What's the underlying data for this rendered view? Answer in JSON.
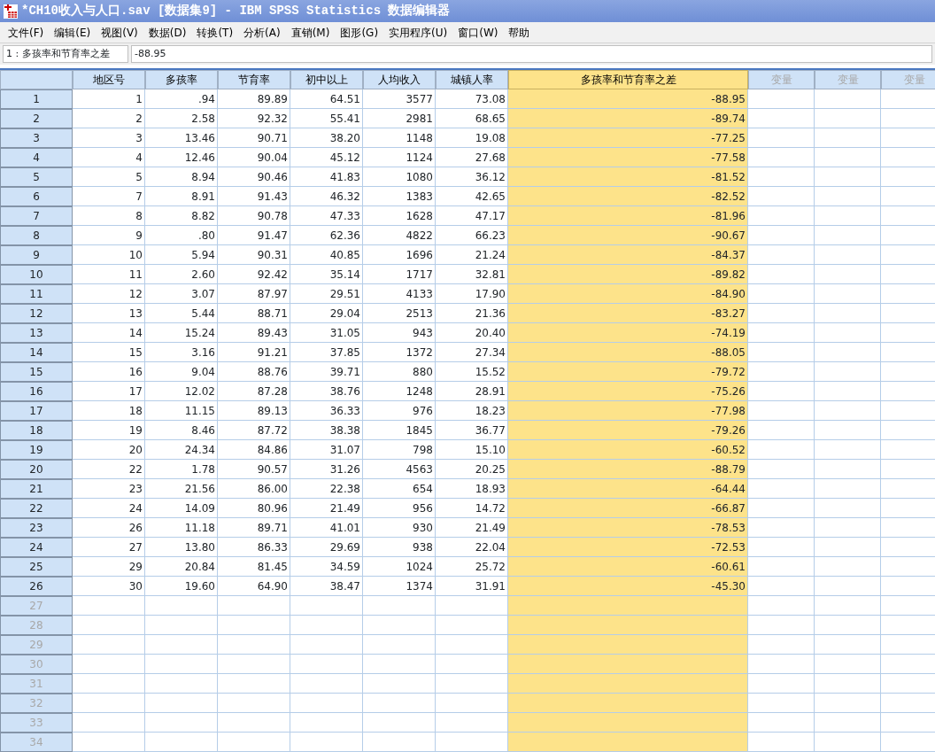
{
  "window": {
    "title": "*CH10收入与人口.sav [数据集9] - IBM SPSS Statistics 数据编辑器"
  },
  "menu": [
    "文件(F)",
    "编辑(E)",
    "视图(V)",
    "数据(D)",
    "转换(T)",
    "分析(A)",
    "直销(M)",
    "图形(G)",
    "实用程序(U)",
    "窗口(W)",
    "帮助"
  ],
  "cell_editor": {
    "label": "1 : 多孩率和节育率之差",
    "value": "-88.95"
  },
  "columns": [
    {
      "name": "地区号",
      "disabled": false,
      "selected": false
    },
    {
      "name": "多孩率",
      "disabled": false,
      "selected": false
    },
    {
      "name": "节育率",
      "disabled": false,
      "selected": false
    },
    {
      "name": "初中以上",
      "disabled": false,
      "selected": false
    },
    {
      "name": "人均收入",
      "disabled": false,
      "selected": false
    },
    {
      "name": "城镇人率",
      "disabled": false,
      "selected": false
    },
    {
      "name": "多孩率和节育率之差",
      "disabled": false,
      "selected": true
    },
    {
      "name": "变量",
      "disabled": true,
      "selected": false
    },
    {
      "name": "变量",
      "disabled": true,
      "selected": false
    },
    {
      "name": "变量",
      "disabled": true,
      "selected": false
    }
  ],
  "rows": [
    {
      "number": "1",
      "disabled": false,
      "cells": [
        "1",
        ".94",
        "89.89",
        "64.51",
        "3577",
        "73.08",
        "-88.95"
      ]
    },
    {
      "number": "2",
      "disabled": false,
      "cells": [
        "2",
        "2.58",
        "92.32",
        "55.41",
        "2981",
        "68.65",
        "-89.74"
      ]
    },
    {
      "number": "3",
      "disabled": false,
      "cells": [
        "3",
        "13.46",
        "90.71",
        "38.20",
        "1148",
        "19.08",
        "-77.25"
      ]
    },
    {
      "number": "4",
      "disabled": false,
      "cells": [
        "4",
        "12.46",
        "90.04",
        "45.12",
        "1124",
        "27.68",
        "-77.58"
      ]
    },
    {
      "number": "5",
      "disabled": false,
      "cells": [
        "5",
        "8.94",
        "90.46",
        "41.83",
        "1080",
        "36.12",
        "-81.52"
      ]
    },
    {
      "number": "6",
      "disabled": false,
      "cells": [
        "7",
        "8.91",
        "91.43",
        "46.32",
        "1383",
        "42.65",
        "-82.52"
      ]
    },
    {
      "number": "7",
      "disabled": false,
      "cells": [
        "8",
        "8.82",
        "90.78",
        "47.33",
        "1628",
        "47.17",
        "-81.96"
      ]
    },
    {
      "number": "8",
      "disabled": false,
      "cells": [
        "9",
        ".80",
        "91.47",
        "62.36",
        "4822",
        "66.23",
        "-90.67"
      ]
    },
    {
      "number": "9",
      "disabled": false,
      "cells": [
        "10",
        "5.94",
        "90.31",
        "40.85",
        "1696",
        "21.24",
        "-84.37"
      ]
    },
    {
      "number": "10",
      "disabled": false,
      "cells": [
        "11",
        "2.60",
        "92.42",
        "35.14",
        "1717",
        "32.81",
        "-89.82"
      ]
    },
    {
      "number": "11",
      "disabled": false,
      "cells": [
        "12",
        "3.07",
        "87.97",
        "29.51",
        "4133",
        "17.90",
        "-84.90"
      ]
    },
    {
      "number": "12",
      "disabled": false,
      "cells": [
        "13",
        "5.44",
        "88.71",
        "29.04",
        "2513",
        "21.36",
        "-83.27"
      ]
    },
    {
      "number": "13",
      "disabled": false,
      "cells": [
        "14",
        "15.24",
        "89.43",
        "31.05",
        "943",
        "20.40",
        "-74.19"
      ]
    },
    {
      "number": "14",
      "disabled": false,
      "cells": [
        "15",
        "3.16",
        "91.21",
        "37.85",
        "1372",
        "27.34",
        "-88.05"
      ]
    },
    {
      "number": "15",
      "disabled": false,
      "cells": [
        "16",
        "9.04",
        "88.76",
        "39.71",
        "880",
        "15.52",
        "-79.72"
      ]
    },
    {
      "number": "16",
      "disabled": false,
      "cells": [
        "17",
        "12.02",
        "87.28",
        "38.76",
        "1248",
        "28.91",
        "-75.26"
      ]
    },
    {
      "number": "17",
      "disabled": false,
      "cells": [
        "18",
        "11.15",
        "89.13",
        "36.33",
        "976",
        "18.23",
        "-77.98"
      ]
    },
    {
      "number": "18",
      "disabled": false,
      "cells": [
        "19",
        "8.46",
        "87.72",
        "38.38",
        "1845",
        "36.77",
        "-79.26"
      ]
    },
    {
      "number": "19",
      "disabled": false,
      "cells": [
        "20",
        "24.34",
        "84.86",
        "31.07",
        "798",
        "15.10",
        "-60.52"
      ]
    },
    {
      "number": "20",
      "disabled": false,
      "cells": [
        "22",
        "1.78",
        "90.57",
        "31.26",
        "4563",
        "20.25",
        "-88.79"
      ]
    },
    {
      "number": "21",
      "disabled": false,
      "cells": [
        "23",
        "21.56",
        "86.00",
        "22.38",
        "654",
        "18.93",
        "-64.44"
      ]
    },
    {
      "number": "22",
      "disabled": false,
      "cells": [
        "24",
        "14.09",
        "80.96",
        "21.49",
        "956",
        "14.72",
        "-66.87"
      ]
    },
    {
      "number": "23",
      "disabled": false,
      "cells": [
        "26",
        "11.18",
        "89.71",
        "41.01",
        "930",
        "21.49",
        "-78.53"
      ]
    },
    {
      "number": "24",
      "disabled": false,
      "cells": [
        "27",
        "13.80",
        "86.33",
        "29.69",
        "938",
        "22.04",
        "-72.53"
      ]
    },
    {
      "number": "25",
      "disabled": false,
      "cells": [
        "29",
        "20.84",
        "81.45",
        "34.59",
        "1024",
        "25.72",
        "-60.61"
      ]
    },
    {
      "number": "26",
      "disabled": false,
      "cells": [
        "30",
        "19.60",
        "64.90",
        "38.47",
        "1374",
        "31.91",
        "-45.30"
      ]
    },
    {
      "number": "27",
      "disabled": true,
      "cells": []
    },
    {
      "number": "28",
      "disabled": true,
      "cells": []
    },
    {
      "number": "29",
      "disabled": true,
      "cells": []
    },
    {
      "number": "30",
      "disabled": true,
      "cells": []
    },
    {
      "number": "31",
      "disabled": true,
      "cells": []
    },
    {
      "number": "32",
      "disabled": true,
      "cells": []
    },
    {
      "number": "33",
      "disabled": true,
      "cells": []
    },
    {
      "number": "34",
      "disabled": true,
      "cells": []
    }
  ]
}
